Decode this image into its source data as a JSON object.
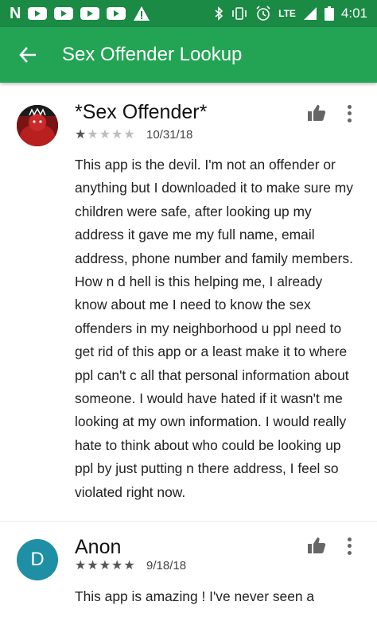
{
  "status_bar": {
    "left_icons": [
      "netflix-n-icon",
      "youtube-icon",
      "youtube-icon",
      "youtube-icon",
      "youtube-icon",
      "warning-icon"
    ],
    "netflix_letter": "N",
    "network_label": "LTE",
    "time": "4:01"
  },
  "app_bar": {
    "title": "Sex Offender Lookup",
    "accent_color": "#23a455"
  },
  "reviews": [
    {
      "author": "*Sex Offender*",
      "rating": 1,
      "rating_max": 5,
      "date": "10/31/18",
      "body": "This app is the devil. I'm not an offender or anything but I downloaded it to make sure my children were safe, after looking up my address it gave me my full name, email address, phone number and family members. How n d hell is this helping me, I already know about me I need to know the sex offenders in my neighborhood u ppl need to get rid of this app or a least make it to where ppl can't c all that personal information about someone. I would have hated if it wasn't me looking at my own information. I would really hate to think about who could be looking up ppl by just putting n there address, I feel so violated right now."
    },
    {
      "author": "Anon",
      "avatar_letter": "D",
      "rating": 5,
      "rating_max": 5,
      "date": "9/18/18",
      "body": "This app is amazing ! I've never seen a"
    }
  ]
}
